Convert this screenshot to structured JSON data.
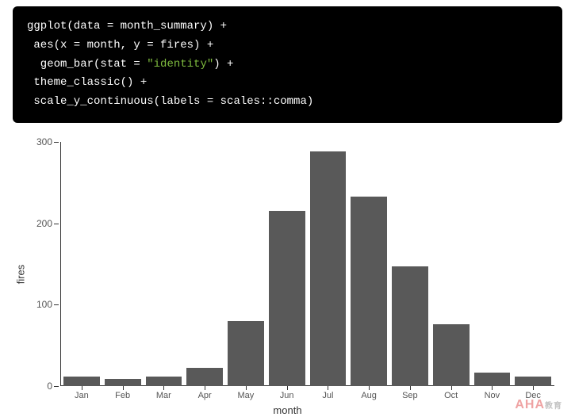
{
  "code": {
    "line1_a": "ggplot(data = month_summary) +",
    "line2_a": " aes(x = month, y = fires) +",
    "line3_a": "  geom_bar(stat = ",
    "line3_str": "\"identity\"",
    "line3_b": ") +",
    "line4_a": " theme_classic() +",
    "line5_a": " scale_y_continuous(labels = scales::comma)"
  },
  "chart_data": {
    "type": "bar",
    "categories": [
      "Jan",
      "Feb",
      "Mar",
      "Apr",
      "May",
      "Jun",
      "Jul",
      "Aug",
      "Sep",
      "Oct",
      "Nov",
      "Dec"
    ],
    "values": [
      12,
      9,
      12,
      22,
      80,
      215,
      288,
      233,
      147,
      76,
      17,
      12
    ],
    "xlabel": "month",
    "ylabel": "fires",
    "ylim": [
      0,
      300
    ],
    "yticks": [
      0,
      100,
      200,
      300
    ]
  },
  "watermark": {
    "main": "AHA",
    "sub": "教育"
  }
}
